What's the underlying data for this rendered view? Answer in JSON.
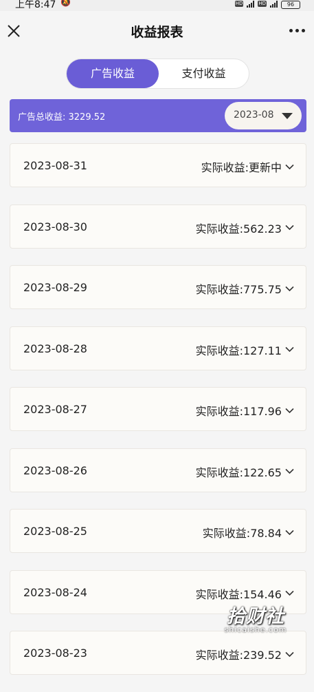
{
  "status": {
    "time": "上午8:47",
    "battery": "96",
    "network_badges": [
      "HD",
      "HD"
    ]
  },
  "nav": {
    "title": "收益报表"
  },
  "tabs": [
    {
      "label": "广告收益",
      "active": true
    },
    {
      "label": "支付收益",
      "active": false
    }
  ],
  "summary": {
    "total_label": "广告总收益: 3229.52",
    "month": "2023-08"
  },
  "records": [
    {
      "date": "2023-08-31",
      "income": "实际收益:更新中"
    },
    {
      "date": "2023-08-30",
      "income": "实际收益:562.23"
    },
    {
      "date": "2023-08-29",
      "income": "实际收益:775.75"
    },
    {
      "date": "2023-08-28",
      "income": "实际收益:127.11"
    },
    {
      "date": "2023-08-27",
      "income": "实际收益:117.96"
    },
    {
      "date": "2023-08-26",
      "income": "实际收益:122.65"
    },
    {
      "date": "2023-08-25",
      "income": "实际收益:78.84"
    },
    {
      "date": "2023-08-24",
      "income": "实际收益:154.46"
    },
    {
      "date": "2023-08-23",
      "income": "实际收益:239.52"
    }
  ],
  "watermark": {
    "text": "拾财社",
    "sub": "shicaishe.com"
  },
  "colors": {
    "accent": "#6a5dd6",
    "summary_bg": "#6f63d9",
    "row_bg": "#fcfbf8"
  }
}
